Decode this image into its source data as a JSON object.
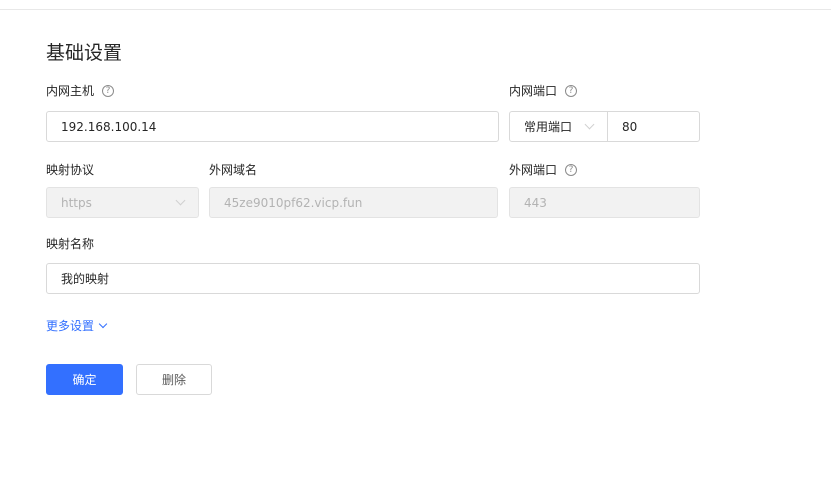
{
  "section": {
    "title": "基础设置"
  },
  "internal_host": {
    "label": "内网主机",
    "value": "192.168.100.14"
  },
  "internal_port": {
    "label": "内网端口",
    "select_value": "常用端口",
    "value": "80"
  },
  "protocol": {
    "label": "映射协议",
    "value": "https"
  },
  "domain": {
    "label": "外网域名",
    "value": "45ze9010pf62.vicp.fun"
  },
  "external_port": {
    "label": "外网端口",
    "value": "443"
  },
  "mapping_name": {
    "label": "映射名称",
    "value": "我的映射"
  },
  "more_settings": {
    "label": "更多设置"
  },
  "actions": {
    "confirm": "确定",
    "delete": "删除"
  },
  "colors": {
    "primary": "#3370ff",
    "disabled_bg": "#f2f2f2",
    "border": "#d9d9d9"
  }
}
